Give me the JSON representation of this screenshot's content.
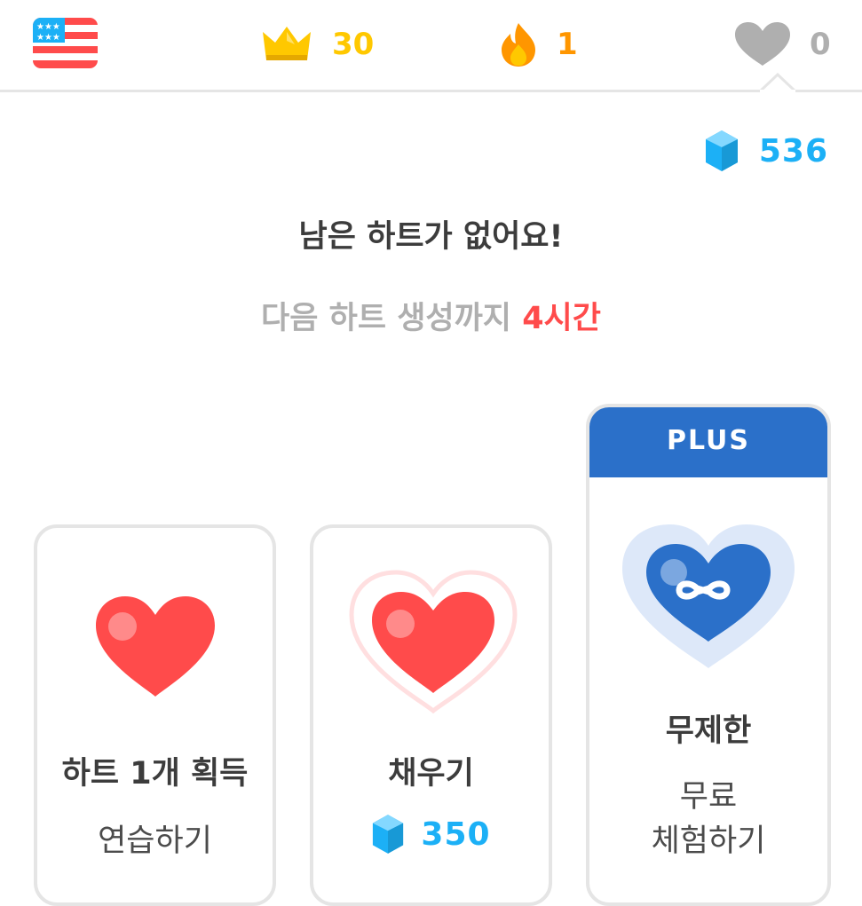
{
  "topbar": {
    "flag_icon": "us-flag-icon",
    "crowns": "30",
    "streak": "1",
    "hearts": "0",
    "colors": {
      "crown": "#ffc800",
      "streak": "#ff9600",
      "hearts_empty": "#afafaf"
    }
  },
  "gems": {
    "count": "536",
    "color": "#1cb0f6"
  },
  "message": {
    "title": "남은 하트가 없어요!",
    "subtitle_prefix": "다음 하트 생성까지 ",
    "subtitle_highlight": "4시간",
    "highlight_color": "#ff4b4b"
  },
  "cards": [
    {
      "title": "하트 1개 획득",
      "subtitle": "연습하기",
      "icon": "heart-icon"
    },
    {
      "title": "채우기",
      "price": "350",
      "icon": "heart-refill-icon"
    },
    {
      "badge": "PLUS",
      "title": "무제한",
      "subtitle_line1": "무료",
      "subtitle_line2": "체험하기",
      "icon": "infinite-heart-icon",
      "badge_color": "#2b70c9"
    }
  ]
}
